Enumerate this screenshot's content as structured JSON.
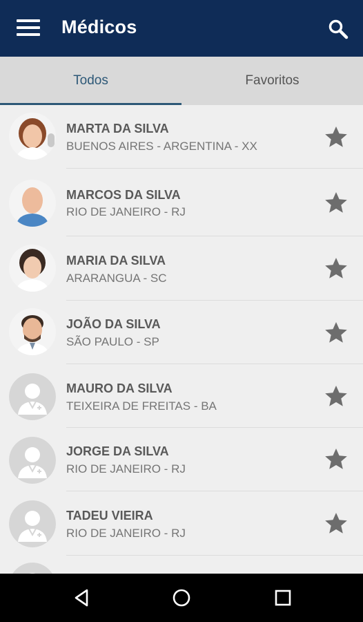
{
  "appbar": {
    "title": "Médicos",
    "background": "#0f2c57"
  },
  "tabs": [
    {
      "label": "Todos",
      "active": true
    },
    {
      "label": "Favoritos",
      "active": false
    }
  ],
  "doctors": [
    {
      "name": "MARTA DA SILVA",
      "location": "BUENOS AIRES - ARGENTINA - XX",
      "avatar": "photo-woman-curly-hair"
    },
    {
      "name": "MARCOS DA SILVA",
      "location": "RIO DE JANEIRO - RJ",
      "avatar": "photo-man-bald"
    },
    {
      "name": "MARIA DA SILVA",
      "location": "ARARANGUA - SC",
      "avatar": "photo-woman-dark-hair"
    },
    {
      "name": "JOÃO DA SILVA",
      "location": "SÃO PAULO - SP",
      "avatar": "photo-man-beard"
    },
    {
      "name": "MAURO DA SILVA",
      "location": "TEIXEIRA DE FREITAS - BA",
      "avatar": "doctor-placeholder-icon"
    },
    {
      "name": "JORGE DA SILVA",
      "location": "RIO DE JANEIRO - RJ",
      "avatar": "doctor-placeholder-icon"
    },
    {
      "name": "TADEU VIEIRA",
      "location": "RIO DE JANEIRO - RJ",
      "avatar": "doctor-placeholder-icon"
    }
  ],
  "colors": {
    "star": "#6d6d6d",
    "accent": "#2d5877"
  }
}
